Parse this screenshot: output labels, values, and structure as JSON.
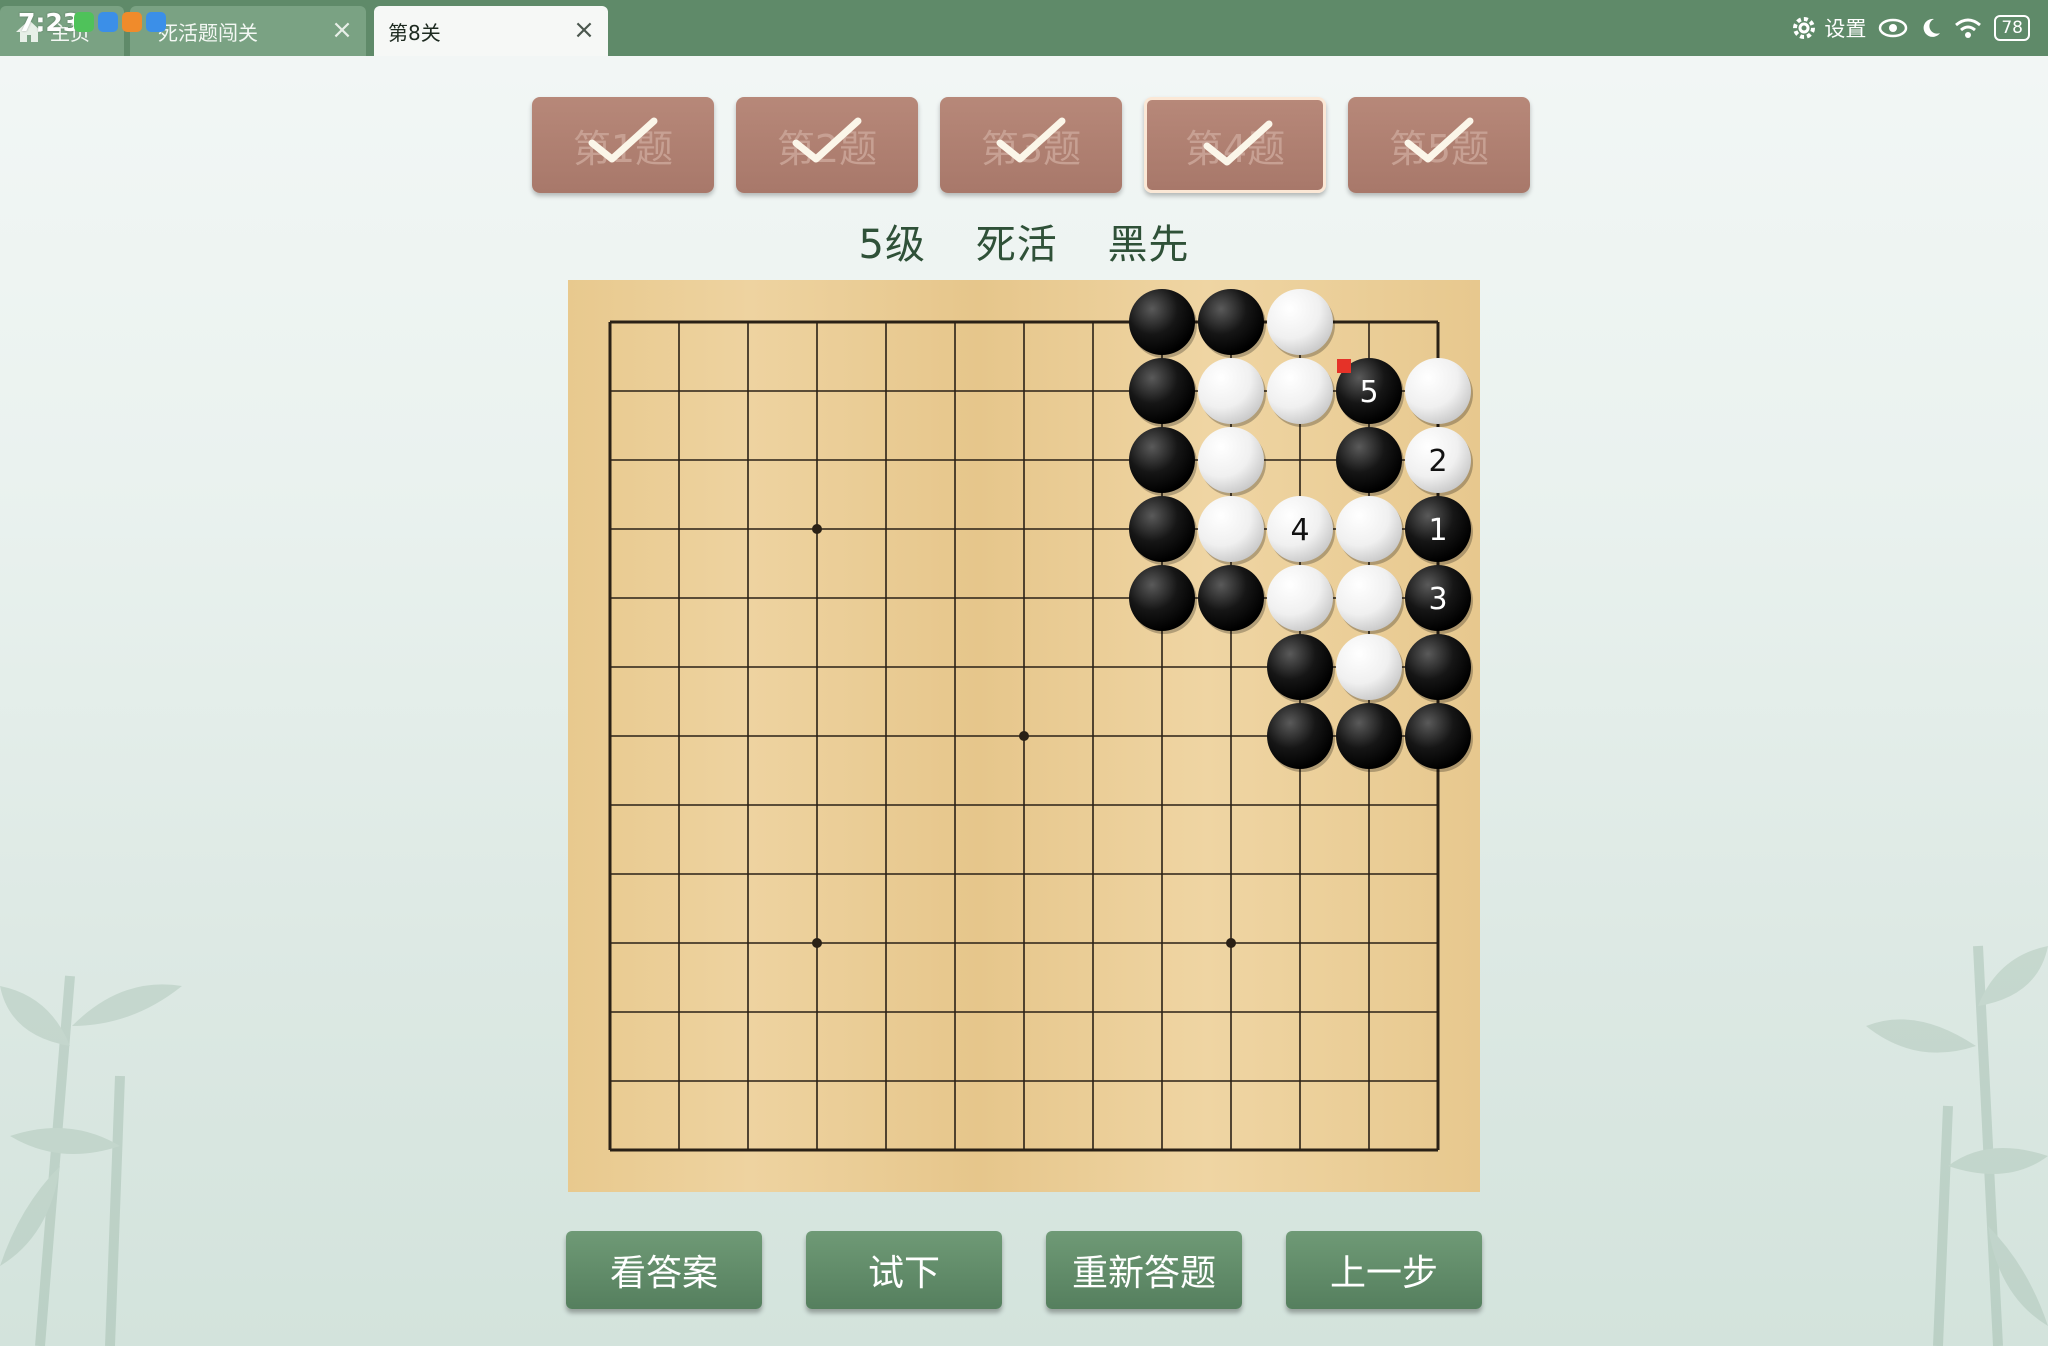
{
  "status": {
    "time": "7:23",
    "battery": "78"
  },
  "tabs": [
    {
      "label": "主页"
    },
    {
      "label": "死活题闯关"
    },
    {
      "label": "第8关"
    }
  ],
  "settings_label": "设置",
  "levels": [
    {
      "label": "第1题",
      "done": true
    },
    {
      "label": "第2题",
      "done": true
    },
    {
      "label": "第3题",
      "done": true
    },
    {
      "label": "第4题",
      "done": true,
      "current": true
    },
    {
      "label": "第5题",
      "done": true
    }
  ],
  "problem": {
    "level": "5级",
    "type": "死活",
    "to_play": "黑先"
  },
  "board": {
    "size": 13,
    "star_points": [
      [
        3,
        3
      ],
      [
        3,
        9
      ],
      [
        6,
        6
      ],
      [
        9,
        3
      ],
      [
        9,
        9
      ]
    ],
    "last_move_marker": [
      11,
      1
    ],
    "stones": [
      {
        "col": 8,
        "row": 0,
        "color": "black"
      },
      {
        "col": 9,
        "row": 0,
        "color": "black"
      },
      {
        "col": 10,
        "row": 0,
        "color": "white"
      },
      {
        "col": 8,
        "row": 1,
        "color": "black"
      },
      {
        "col": 9,
        "row": 1,
        "color": "white"
      },
      {
        "col": 10,
        "row": 1,
        "color": "white"
      },
      {
        "col": 11,
        "row": 1,
        "color": "black",
        "label": "5"
      },
      {
        "col": 12,
        "row": 1,
        "color": "white"
      },
      {
        "col": 8,
        "row": 2,
        "color": "black"
      },
      {
        "col": 9,
        "row": 2,
        "color": "white"
      },
      {
        "col": 11,
        "row": 2,
        "color": "black"
      },
      {
        "col": 12,
        "row": 2,
        "color": "white",
        "label": "2"
      },
      {
        "col": 8,
        "row": 3,
        "color": "black"
      },
      {
        "col": 9,
        "row": 3,
        "color": "white"
      },
      {
        "col": 10,
        "row": 3,
        "color": "white",
        "label": "4"
      },
      {
        "col": 11,
        "row": 3,
        "color": "white"
      },
      {
        "col": 12,
        "row": 3,
        "color": "black",
        "label": "1"
      },
      {
        "col": 8,
        "row": 4,
        "color": "black"
      },
      {
        "col": 9,
        "row": 4,
        "color": "black"
      },
      {
        "col": 10,
        "row": 4,
        "color": "white"
      },
      {
        "col": 11,
        "row": 4,
        "color": "white"
      },
      {
        "col": 12,
        "row": 4,
        "color": "black",
        "label": "3"
      },
      {
        "col": 10,
        "row": 5,
        "color": "black"
      },
      {
        "col": 11,
        "row": 5,
        "color": "white"
      },
      {
        "col": 12,
        "row": 5,
        "color": "black"
      },
      {
        "col": 10,
        "row": 6,
        "color": "black"
      },
      {
        "col": 11,
        "row": 6,
        "color": "black"
      },
      {
        "col": 12,
        "row": 6,
        "color": "black"
      }
    ]
  },
  "actions": {
    "show_answer": "看答案",
    "try": "试下",
    "retry": "重新答题",
    "undo": "上一步"
  },
  "colors": {
    "topbar": "#5f8a69",
    "level_button": "#a8786a",
    "action_button": "#5f8a67",
    "board": "#e9cb93"
  }
}
